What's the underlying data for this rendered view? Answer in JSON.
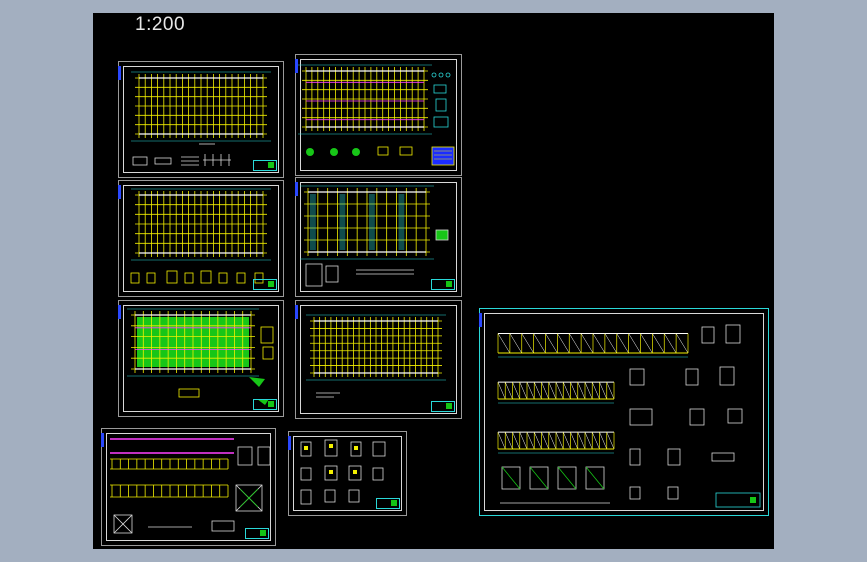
{
  "viewport": {
    "scale_label": "1:200",
    "background_color": "#a3afc0",
    "canvas_color": "#000000"
  },
  "colors": {
    "frame": "#d8d8d8",
    "grid": "#f4f000",
    "axis": "#ffffff",
    "dim": "#2ad9d9",
    "magenta": "#ff40ff",
    "fill": "#17c617",
    "marker": "#2a48ff"
  },
  "sheets": [
    {
      "id": "sheet-1",
      "kind": "plan-grid"
    },
    {
      "id": "sheet-2",
      "kind": "plan-grid-magenta"
    },
    {
      "id": "sheet-3",
      "kind": "plan-grid"
    },
    {
      "id": "sheet-4",
      "kind": "plan-grid-cyan"
    },
    {
      "id": "sheet-5",
      "kind": "plan-green"
    },
    {
      "id": "sheet-6",
      "kind": "plan-grid-dense"
    },
    {
      "id": "sheet-7",
      "kind": "elevations"
    },
    {
      "id": "sheet-8",
      "kind": "details"
    },
    {
      "id": "sheet-9",
      "kind": "sections-details"
    }
  ]
}
